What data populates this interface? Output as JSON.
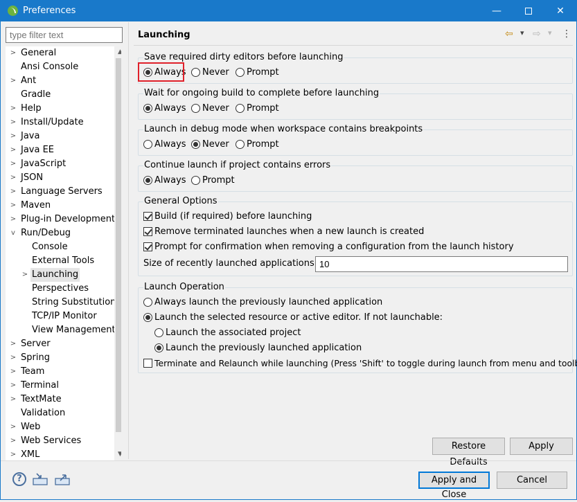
{
  "window": {
    "title": "Preferences",
    "min_glyph": "—",
    "close_glyph": "✕"
  },
  "filter": {
    "placeholder": "type filter text"
  },
  "tree": {
    "items": [
      {
        "label": "General",
        "chev": ">"
      },
      {
        "label": "Ansi Console",
        "chev": ""
      },
      {
        "label": "Ant",
        "chev": ">"
      },
      {
        "label": "Gradle",
        "chev": ""
      },
      {
        "label": "Help",
        "chev": ">"
      },
      {
        "label": "Install/Update",
        "chev": ">"
      },
      {
        "label": "Java",
        "chev": ">"
      },
      {
        "label": "Java EE",
        "chev": ">"
      },
      {
        "label": "JavaScript",
        "chev": ">"
      },
      {
        "label": "JSON",
        "chev": ">"
      },
      {
        "label": "Language Servers",
        "chev": ">"
      },
      {
        "label": "Maven",
        "chev": ">"
      },
      {
        "label": "Plug-in Development",
        "chev": ">"
      },
      {
        "label": "Run/Debug",
        "chev": "v"
      },
      {
        "label": "Console",
        "chev": ""
      },
      {
        "label": "External Tools",
        "chev": ""
      },
      {
        "label": "Launching",
        "chev": ">"
      },
      {
        "label": "Perspectives",
        "chev": ""
      },
      {
        "label": "String Substitution",
        "chev": ""
      },
      {
        "label": "TCP/IP Monitor",
        "chev": ""
      },
      {
        "label": "View Management",
        "chev": ""
      },
      {
        "label": "Server",
        "chev": ">"
      },
      {
        "label": "Spring",
        "chev": ">"
      },
      {
        "label": "Team",
        "chev": ">"
      },
      {
        "label": "Terminal",
        "chev": ">"
      },
      {
        "label": "TextMate",
        "chev": ">"
      },
      {
        "label": "Validation",
        "chev": ""
      },
      {
        "label": "Web",
        "chev": ">"
      },
      {
        "label": "Web Services",
        "chev": ">"
      },
      {
        "label": "XML",
        "chev": ">"
      }
    ]
  },
  "page": {
    "title": "Launching"
  },
  "nav": {
    "back": "⇦",
    "back_menu": "▾",
    "forward": "⇨",
    "forward_menu": "▾",
    "view_menu": "⋮"
  },
  "groups": {
    "save": {
      "title": "Save required dirty editors before launching",
      "always": "Always",
      "never": "Never",
      "prompt": "Prompt"
    },
    "wait": {
      "title": "Wait for ongoing build to complete before launching",
      "always": "Always",
      "never": "Never",
      "prompt": "Prompt"
    },
    "debug": {
      "title": "Launch in debug mode when workspace contains breakpoints",
      "always": "Always",
      "never": "Never",
      "prompt": "Prompt"
    },
    "errors": {
      "title": "Continue launch if project contains errors",
      "always": "Always",
      "prompt": "Prompt"
    },
    "general": {
      "title": "General Options",
      "build": "Build (if required) before launching",
      "remove": "Remove terminated launches when a new launch is created",
      "confirm": "Prompt for confirmation when removing a configuration from the launch history",
      "size_label": "Size of recently launched applications list:",
      "size_value": "10"
    },
    "operation": {
      "title": "Launch Operation",
      "always_prev": "Always launch the previously launched application",
      "selected": "Launch the selected resource or active editor. If not launchable:",
      "associated": "Launch the associated project",
      "prev": "Launch the previously launched application",
      "terminate": "Terminate and Relaunch while launching (Press 'Shift' to toggle during launch from menu and toolbar)"
    }
  },
  "buttons": {
    "restore": "Restore Defaults",
    "apply": "Apply",
    "apply_close": "Apply and Close",
    "cancel": "Cancel"
  },
  "icons": {
    "help": "?"
  },
  "colors": {
    "titlebar": "#1979ca",
    "highlight": "#e0202a",
    "default_button": "#0078d7"
  }
}
